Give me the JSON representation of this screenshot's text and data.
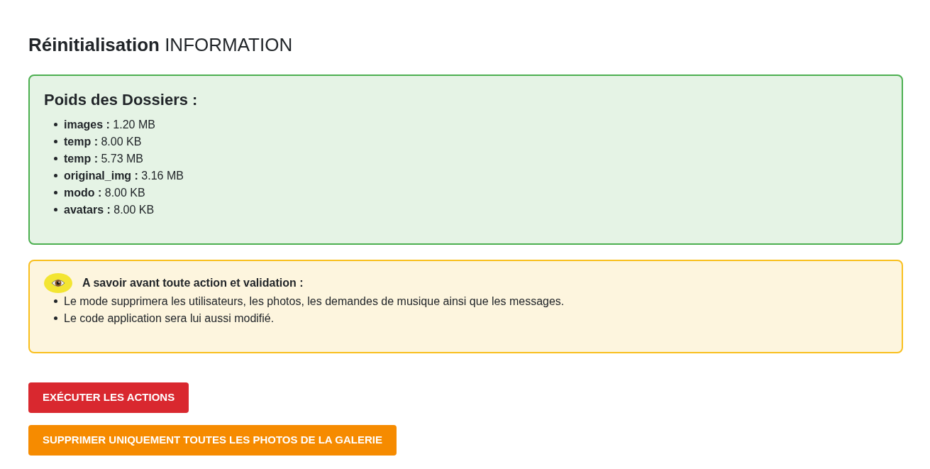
{
  "page_title": "**Réinitialisation** INFORMATION",
  "folder_sizes": {
    "title": "Poids des Dossiers :",
    "items": [
      "**images :** 1.20 MB",
      "**temp :** 8.00 KB",
      "**temp :** 5.73 MB",
      "**original_img :** 3.16 MB",
      "**modo :** 8.00 KB",
      "**avatars :** 8.00 KB"
    ]
  },
  "notice": {
    "title": "A savoir avant toute action et validation :",
    "items": [
      "Le mode supprimera les utilisateurs, les photos, les demandes de musique ainsi que les messages.",
      "Le code application sera lui aussi modifié."
    ]
  },
  "buttons": [
    {
      "label": "EXÉCUTER LES ACTIONS",
      "kind": "danger"
    },
    {
      "label": "SUPPRIMER UNIQUEMENT TOUTES LES PHOTOS DE LA GALERIE",
      "kind": "warning"
    }
  ]
}
